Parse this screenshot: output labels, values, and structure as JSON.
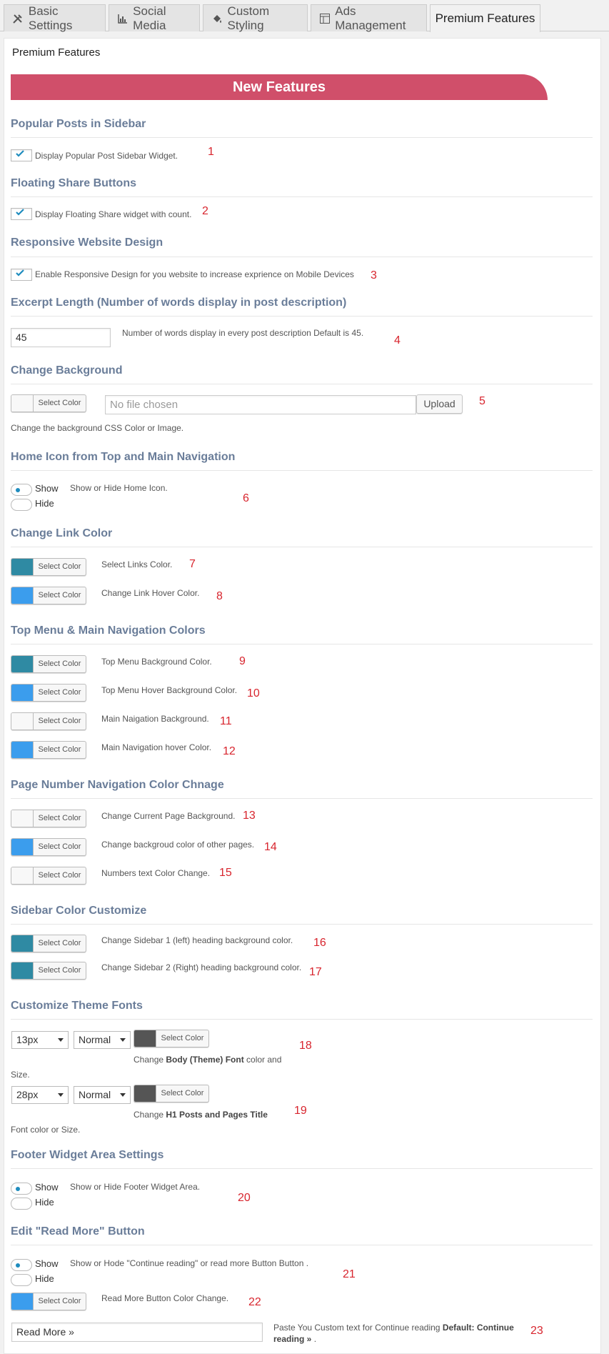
{
  "tabs": [
    {
      "label": "Basic Settings",
      "icon": "tools-icon"
    },
    {
      "label": "Social Media",
      "icon": "chart-icon"
    },
    {
      "label": "Custom Styling",
      "icon": "paint-bucket-icon"
    },
    {
      "label": "Ads Management",
      "icon": "layout-icon"
    },
    {
      "label": "Premium Features",
      "icon": ""
    }
  ],
  "panel_title": "Premium Features",
  "banner": "New Features",
  "colors": {
    "teal": "#2f8aa3",
    "blue": "#3b9ded",
    "white": "#f8f8f8",
    "dark": "#555555",
    "banner": "#d04f6a",
    "heading": "#6a7d99",
    "annotation": "#d8252e"
  },
  "sections": {
    "popular": {
      "title": "Popular Posts in Sidebar",
      "label": "Display Popular Post Sidebar Widget.",
      "num": "1"
    },
    "floating": {
      "title": "Floating Share Buttons",
      "label": "Display Floating Share widget with count.",
      "num": "2"
    },
    "responsive": {
      "title": "Responsive Website Design",
      "label": "Enable Responsive Design for you website to increase exprience on Mobile Devices",
      "num": "3"
    },
    "excerpt": {
      "title": "Excerpt Length (Number of words display in post description)",
      "value": "45",
      "desc": "Number of words display in every post description Default is 45.",
      "num": "4"
    },
    "background": {
      "title": "Change Background",
      "picker": "Select Color",
      "file_placeholder": "No file chosen",
      "upload": "Upload",
      "desc": "Change the background CSS Color or Image.",
      "num": "5"
    },
    "home_icon": {
      "title": "Home Icon from Top and Main Navigation",
      "show": "Show",
      "hide": "Hide",
      "desc": "Show or Hide Home Icon.",
      "num": "6"
    },
    "link_color": {
      "title": "Change Link Color",
      "rows": [
        {
          "picker": "Select Color",
          "label": "Select Links Color.",
          "num": "7"
        },
        {
          "picker": "Select Color",
          "label": "Change Link Hover Color.",
          "num": "8"
        }
      ]
    },
    "top_menu": {
      "title": "Top Menu & Main Navigation Colors",
      "rows": [
        {
          "picker": "Select Color",
          "label": "Top Menu Background Color.",
          "num": "9"
        },
        {
          "picker": "Select Color",
          "label": "Top Menu Hover Background Color.",
          "num": "10"
        },
        {
          "picker": "Select Color",
          "label": "Main Naigation Background.",
          "num": "11"
        },
        {
          "picker": "Select Color",
          "label": "Main Navigation hover Color.",
          "num": "12"
        }
      ]
    },
    "page_number": {
      "title": "Page Number Navigation Color Chnage",
      "rows": [
        {
          "picker": "Select Color",
          "label": "Change Current Page Background.",
          "num": "13"
        },
        {
          "picker": "Select Color",
          "label": "Change backgroud color of other pages.",
          "num": "14"
        },
        {
          "picker": "Select Color",
          "label": "Numbers text Color Change.",
          "num": "15"
        }
      ]
    },
    "sidebar_color": {
      "title": "Sidebar Color Customize",
      "rows": [
        {
          "picker": "Select Color",
          "label": "Change Sidebar 1 (left) heading background color.",
          "num": "16"
        },
        {
          "picker": "Select Color",
          "label": "Change Sidebar 2 (Right) heading background color.",
          "num": "17"
        }
      ]
    },
    "fonts": {
      "title": "Customize Theme Fonts",
      "body": {
        "size": "13px",
        "weight": "Normal",
        "picker": "Select Color",
        "pre": "Change ",
        "bold": "Body (Theme) Font",
        "post": " color and",
        "cont": "Size.",
        "num": "18"
      },
      "h1": {
        "size": "28px",
        "weight": "Normal",
        "picker": "Select Color",
        "pre": "Change ",
        "bold": "H1 Posts and Pages Title",
        "post": "",
        "cont": "Font color or Size.",
        "num": "19"
      }
    },
    "footer": {
      "title": "Footer Widget Area Settings",
      "show": "Show",
      "hide": "Hide",
      "desc": "Show or Hide Footer Widget Area.",
      "num": "20"
    },
    "read_more": {
      "title": "Edit \"Read More\" Button",
      "show": "Show",
      "hide": "Hide",
      "desc": "Show or Hode \"Continue reading\" or read more Button Button .",
      "num": "21",
      "picker": "Select Color",
      "color_label": "Read More Button Color Change.",
      "color_num": "22",
      "text_value": "Read More »",
      "text_pre": "Paste You Custom text for Continue reading ",
      "text_bold1": "Default: Continue",
      "text_bold2": "reading » ",
      "text_post": ".",
      "text_num": "23"
    }
  }
}
